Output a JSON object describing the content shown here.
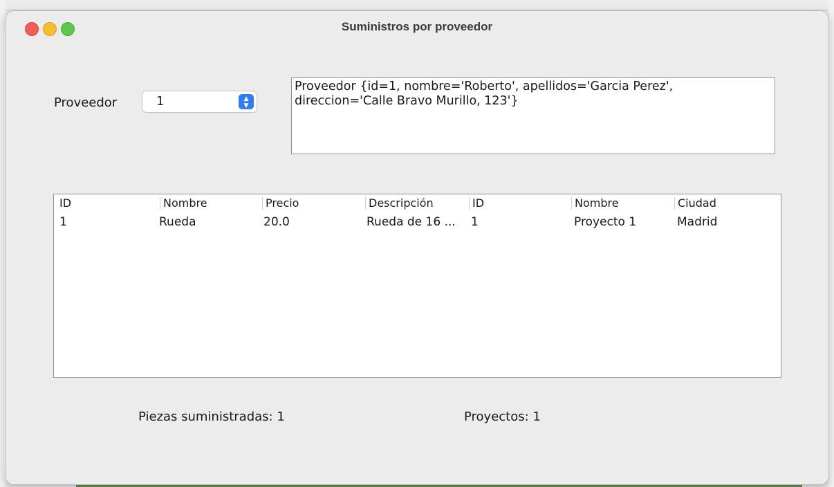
{
  "window": {
    "title": "Suministros por proveedor"
  },
  "form": {
    "proveedor_label": "Proveedor",
    "proveedor_selected": "1"
  },
  "info": {
    "lines": [
      "Proveedor {id=1, nombre='Roberto', apellidos='Garcia Perez',",
      "direccion='Calle Bravo Murillo, 123'}"
    ]
  },
  "table": {
    "headers": [
      "ID",
      "Nombre",
      "Precio",
      "Descripción",
      "ID",
      "Nombre",
      "Ciudad"
    ],
    "rows": [
      [
        "1",
        "Rueda",
        "20.0",
        "Rueda de 16 ...",
        "1",
        "Proyecto 1",
        "Madrid"
      ]
    ]
  },
  "status": {
    "piezas": "Piezas suministradas: 1",
    "proyectos": "Proyectos: 1"
  },
  "colors": {
    "close": "#ee5f57",
    "minimize": "#f5bd30",
    "maximize": "#5fc84a",
    "accent": "#2f7cf6"
  }
}
